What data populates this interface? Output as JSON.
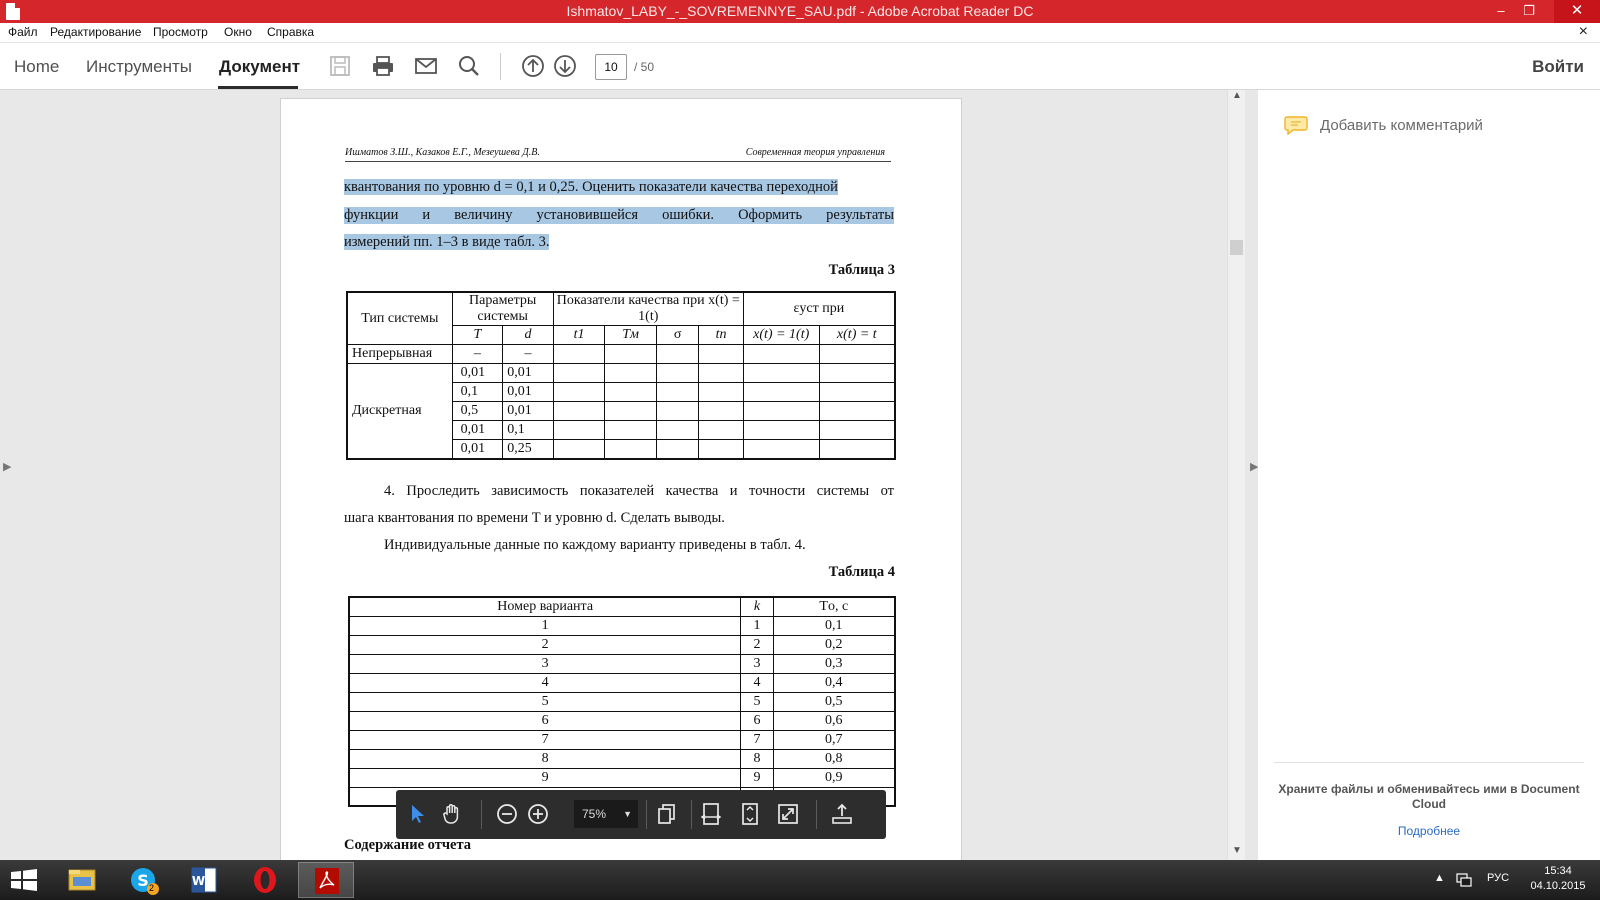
{
  "window": {
    "title": "Ishmatov_LABY_-_SOVREMENNYE_SAU.pdf - Adobe Acrobat Reader DC",
    "minimize": "–",
    "maximize": "❐",
    "close": "✕"
  },
  "menu": {
    "items": [
      "Файл",
      "Редактирование",
      "Просмотр",
      "Окно",
      "Справка"
    ],
    "close": "×"
  },
  "toolbar": {
    "tabs": [
      "Home",
      "Инструменты",
      "Документ"
    ],
    "active_tab": "Документ",
    "page_current": "10",
    "page_total": "/  50",
    "signin": "Войти"
  },
  "document": {
    "running_head_left": "Ишматов З.Ш., Казаков Е.Г., Мезеушева Д.В.",
    "running_head_right": "Современная теория управления",
    "para1_line1": "квантования по уровню d = 0,1 и 0,25. Оценить показатели качества переходной",
    "para1_line2": "функции и величину установившейся ошибки. Оформить результаты",
    "para1_line3": "измерений пп. 1–3 в виде табл. 3.",
    "table3_caption": "Таблица 3",
    "table3": {
      "h_system_type": "Тип системы",
      "h_params": "Параметры системы",
      "h_quality": "Показатели качества при x(t) = 1(t)",
      "h_eps": "εуст при",
      "h_T": "T",
      "h_d": "d",
      "h_t1": "t1",
      "h_Tm": "Tм",
      "h_sigma": "σ",
      "h_tp": "tп",
      "h_x1": "x(t) = 1(t)",
      "h_xt": "x(t) = t",
      "continuous": "Непрерывная",
      "dash": "–",
      "discrete": "Дискретная",
      "rows": [
        {
          "T": "0,01",
          "d": "0,01"
        },
        {
          "T": "0,1",
          "d": "0,01"
        },
        {
          "T": "0,5",
          "d": "0,01"
        },
        {
          "T": "0,01",
          "d": "0,1"
        },
        {
          "T": "0,01",
          "d": "0,25"
        }
      ]
    },
    "para2_line1": "4. Проследить зависимость показателей качества и точности системы от",
    "para2_line2": "шага квантования по времени T и уровню d. Сделать выводы.",
    "para3": "Индивидуальные данные по каждому варианту приведены в табл. 4.",
    "table4_caption": "Таблица 4",
    "table4": {
      "headers": [
        "Номер варианта",
        "k",
        "Tо, с"
      ],
      "rows": [
        [
          "1",
          "1",
          "0,1"
        ],
        [
          "2",
          "2",
          "0,2"
        ],
        [
          "3",
          "3",
          "0,3"
        ],
        [
          "4",
          "4",
          "0,4"
        ],
        [
          "5",
          "5",
          "0,5"
        ],
        [
          "6",
          "6",
          "0,6"
        ],
        [
          "7",
          "7",
          "0,7"
        ],
        [
          "8",
          "8",
          "0,8"
        ],
        [
          "9",
          "9",
          "0,9"
        ]
      ]
    },
    "section_heading": "Содержание отчета"
  },
  "floatbar": {
    "zoom": "75%"
  },
  "rightpane": {
    "add_comment": "Добавить комментарий",
    "cloud_text": "Храните файлы и обменивайтесь ими в Document Cloud",
    "cloud_link": "Подробнее"
  },
  "taskbar": {
    "skype_badge": "2",
    "lang": "РУС",
    "time": "15:34",
    "date": "04.10.2015"
  }
}
